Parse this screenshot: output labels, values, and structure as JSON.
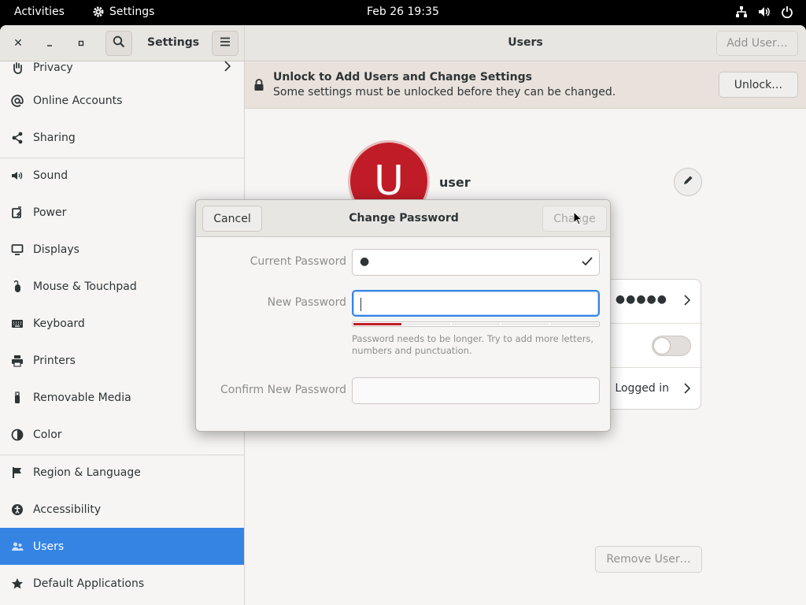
{
  "topbar": {
    "activities": "Activities",
    "app_name": "Settings",
    "clock": "Feb 26  19:35",
    "icons": [
      "network-icon",
      "volume-icon",
      "power-icon"
    ]
  },
  "sidebar": {
    "title": "Settings",
    "items": [
      {
        "label": "Privacy",
        "icon": "hand-icon",
        "has_chevron": true
      },
      {
        "label": "Online Accounts",
        "icon": "at-icon"
      },
      {
        "label": "Sharing",
        "icon": "share-icon"
      },
      {
        "label": "Sound",
        "icon": "speaker-icon"
      },
      {
        "label": "Power",
        "icon": "battery-icon"
      },
      {
        "label": "Displays",
        "icon": "monitor-icon"
      },
      {
        "label": "Mouse & Touchpad",
        "icon": "mouse-icon"
      },
      {
        "label": "Keyboard",
        "icon": "keyboard-icon"
      },
      {
        "label": "Printers",
        "icon": "printer-icon"
      },
      {
        "label": "Removable Media",
        "icon": "usb-icon"
      },
      {
        "label": "Color",
        "icon": "palette-icon"
      },
      {
        "label": "Region & Language",
        "icon": "flag-icon"
      },
      {
        "label": "Accessibility",
        "icon": "accessibility-icon"
      },
      {
        "label": "Users",
        "icon": "users-icon",
        "active": true
      },
      {
        "label": "Default Applications",
        "icon": "star-icon"
      }
    ]
  },
  "main": {
    "title": "Users",
    "add_user": "Add User…",
    "info_title": "Unlock to Add Users and Change Settings",
    "info_text": "Some settings must be unlocked before they can be changed.",
    "unlock": "Unlock…",
    "avatar_letter": "U",
    "username": "user",
    "password_dots": "●●●●●",
    "logged_in": "Logged in",
    "remove_user": "Remove User…"
  },
  "dialog": {
    "title": "Change Password",
    "cancel": "Cancel",
    "change": "Change",
    "current_label": "Current Password",
    "current_value": "●",
    "new_label": "New Password",
    "new_value": "",
    "confirm_label": "Confirm New Password",
    "confirm_value": "",
    "strength_fraction": 0.2,
    "hint": "Password needs to be longer. Try to add more letters, numbers and punctuation."
  },
  "colors": {
    "accent": "#3584e4",
    "avatar": "#c01c28",
    "strength_weak": "#c01c28"
  }
}
